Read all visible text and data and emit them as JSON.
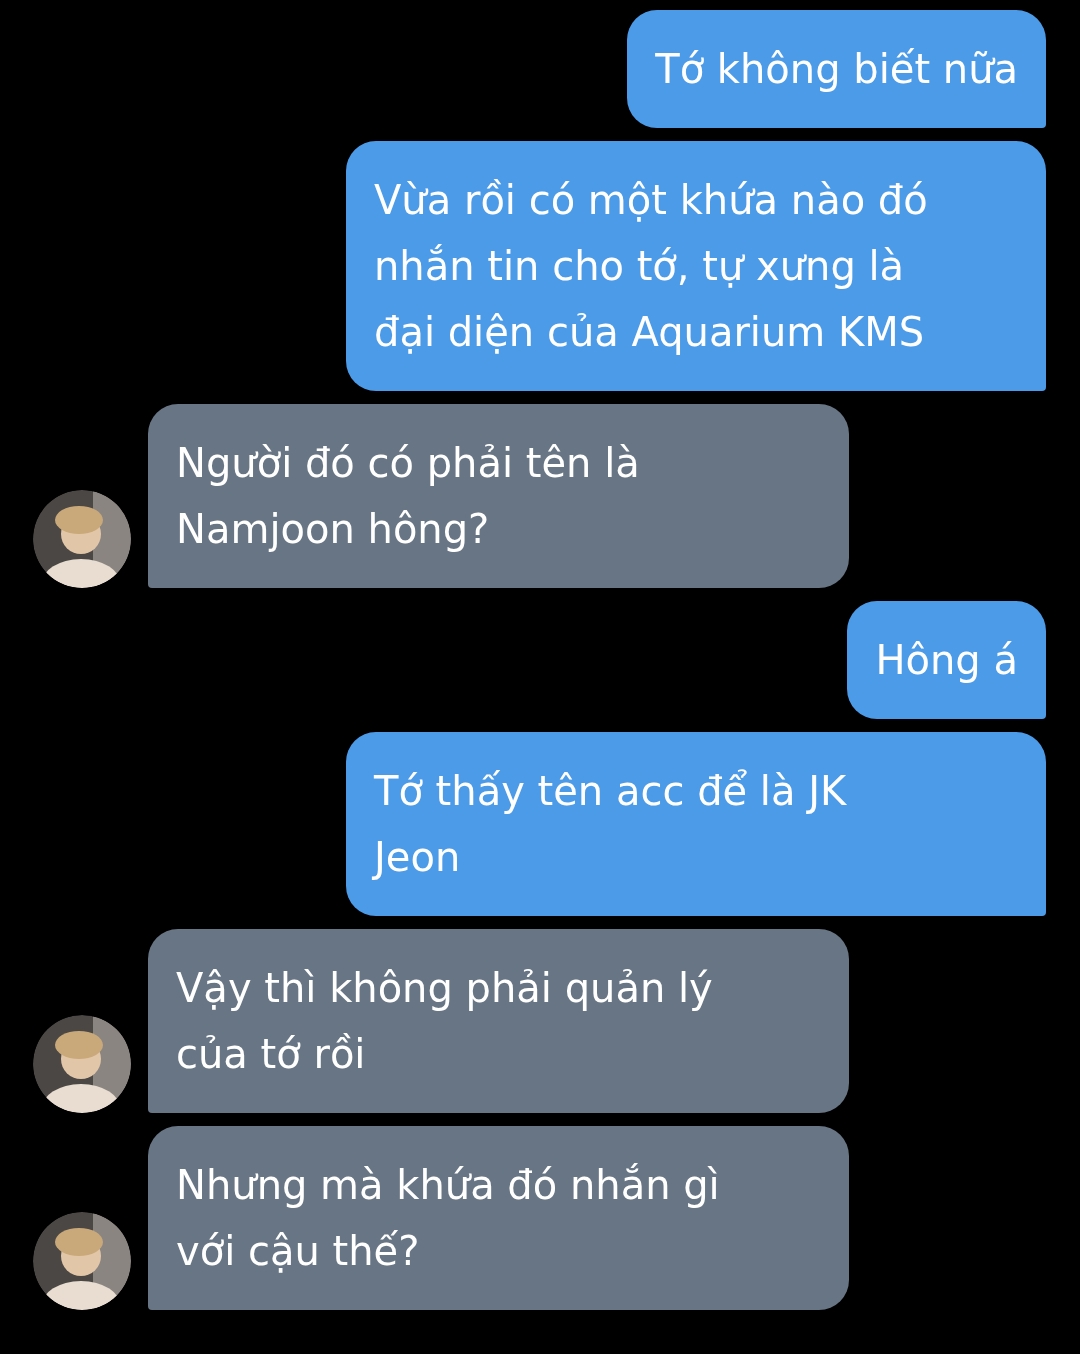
{
  "messages": [
    {
      "kind": "sent",
      "lines": [
        "Tớ không biết nữa"
      ]
    },
    {
      "kind": "sent",
      "lines": [
        "Vừa rồi có một khứa nào đó",
        "nhắn tin cho tớ, tự xưng là",
        "đại diện của Aquarium KMS"
      ]
    },
    {
      "kind": "received",
      "lines": [
        "Người đó có phải tên là",
        "Namjoon hông?"
      ]
    },
    {
      "kind": "sent",
      "lines": [
        "Hông á"
      ]
    },
    {
      "kind": "sent",
      "lines": [
        "Tớ thấy tên acc để là JK",
        "Jeon"
      ]
    },
    {
      "kind": "received",
      "lines": [
        "Vậy thì không phải quản lý",
        "của tớ rồi"
      ]
    },
    {
      "kind": "received",
      "lines": [
        "Nhưng mà khứa đó nhắn gì",
        "với cậu thế?"
      ]
    }
  ]
}
